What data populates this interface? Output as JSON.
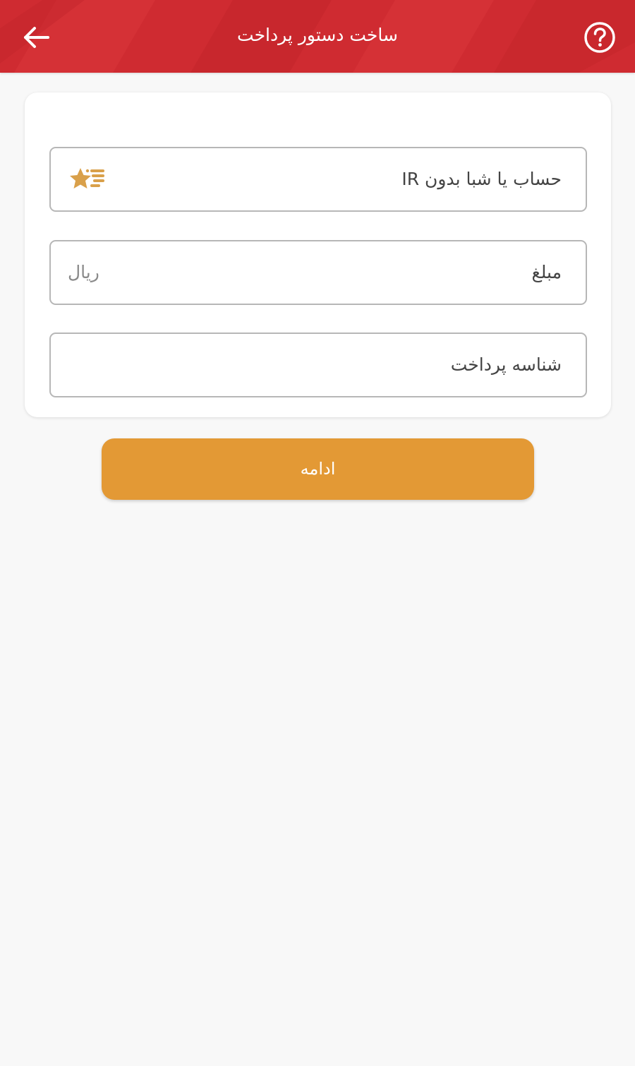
{
  "header": {
    "title": "ساخت دستور پرداخت",
    "background_color": "#cf2b31",
    "back_icon": "arrow-left-icon",
    "help_icon": "question-circle-icon"
  },
  "form": {
    "account_field": {
      "label": "حساب یا شبا بدون IR",
      "icon": "star-favorites-icon",
      "icon_color": "#d9a04a"
    },
    "amount_field": {
      "label": "مبلغ",
      "suffix": "ریال"
    },
    "payment_id_field": {
      "label": "شناسه پرداخت"
    }
  },
  "actions": {
    "continue_label": "ادامه",
    "continue_color": "#e39935"
  }
}
